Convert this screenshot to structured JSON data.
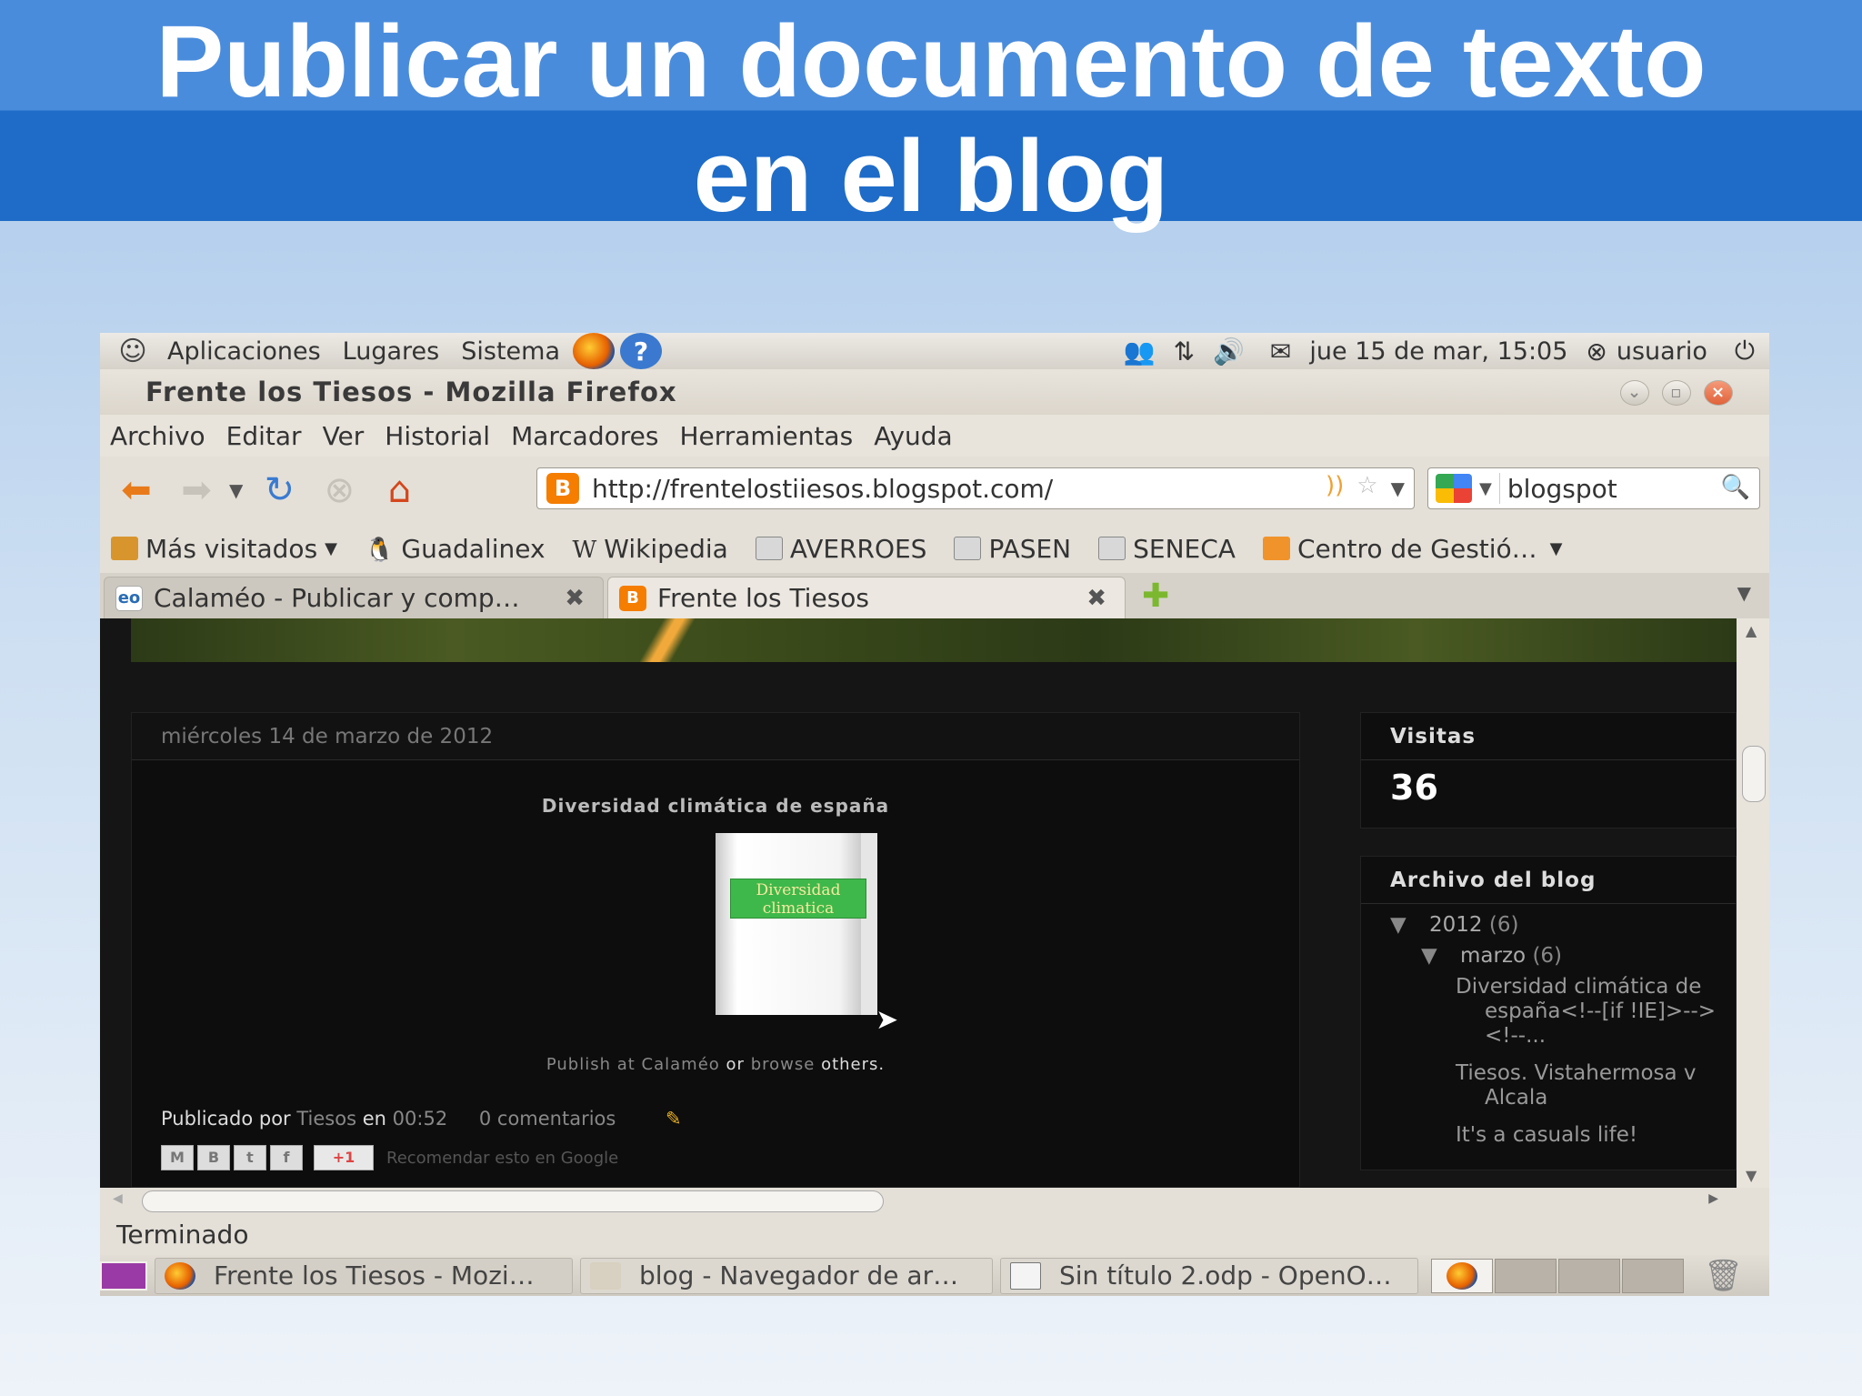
{
  "slide": {
    "title_line1": "Publicar un documento de texto",
    "title_line2": "en el blog"
  },
  "panel": {
    "menus": [
      "Aplicaciones",
      "Lugares",
      "Sistema"
    ],
    "datetime": "jue 15 de mar, 15:05",
    "user": "usuario",
    "help_glyph": "?"
  },
  "window": {
    "title": "Frente los Tiesos - Mozilla Firefox",
    "menu": [
      "Archivo",
      "Editar",
      "Ver",
      "Historial",
      "Marcadores",
      "Herramientas",
      "Ayuda"
    ]
  },
  "navbar": {
    "url": "http://frentelostiiesos.blogspot.com/",
    "search_value": "blogspot"
  },
  "bookmarks": [
    "Más visitados",
    "Guadalinex",
    "Wikipedia",
    "AVERROES",
    "PASEN",
    "SENECA",
    "Centro de Gestió…"
  ],
  "tabs": [
    {
      "label": "Calaméo - Publicar y comp…",
      "icon": "eo"
    },
    {
      "label": "Frente los Tiesos",
      "icon": "B"
    }
  ],
  "blog": {
    "post_date": "miércoles 14 de marzo de 2012",
    "post_title": "Diversidad climática de españa",
    "doc_label": "Diversidad climatica",
    "publish_a": "Publish at Calaméo",
    "publish_or": "or",
    "publish_b": "browse",
    "publish_c": "others.",
    "byline_label": "Publicado por",
    "byline_author": "Tiesos",
    "byline_en": "en",
    "byline_time": "00:52",
    "byline_comments": "0 comentarios",
    "share_text": "Recomendar esto en Google",
    "share_buttons": [
      "M",
      "B",
      "t",
      "f",
      "+1"
    ]
  },
  "sidebar": {
    "visits_title": "Visitas",
    "visits_count": "36",
    "archive_title": "Archivo del blog",
    "year": "2012",
    "year_count": "(6)",
    "month": "marzo",
    "month_count": "(6)",
    "posts": [
      "Diversidad climática de españa<!--[if !IE]>--><!--...",
      "Tiesos. Vistahermosa v Alcala",
      "It's a casuals life!"
    ]
  },
  "status": "Terminado",
  "taskbar": [
    "Frente los Tiesos - Mozi…",
    "blog - Navegador de ar…",
    "Sin título 2.odp - OpenO…"
  ],
  "colors": {
    "title_band_top": "#4a8cdc",
    "title_band_bottom": "#1e6cc8",
    "blog_bg": "#151515",
    "blogger_orange": "#f57d00"
  },
  "icons": [
    "ubuntu-logo-icon",
    "firefox-icon",
    "help-icon",
    "network-icon",
    "volume-icon",
    "mail-icon",
    "user-status-icon",
    "power-icon",
    "back-icon",
    "forward-icon",
    "reload-icon",
    "stop-icon",
    "home-icon",
    "rss-icon",
    "star-icon",
    "search-icon",
    "close-tab-icon",
    "new-tab-icon",
    "pencil-icon",
    "trash-icon"
  ]
}
